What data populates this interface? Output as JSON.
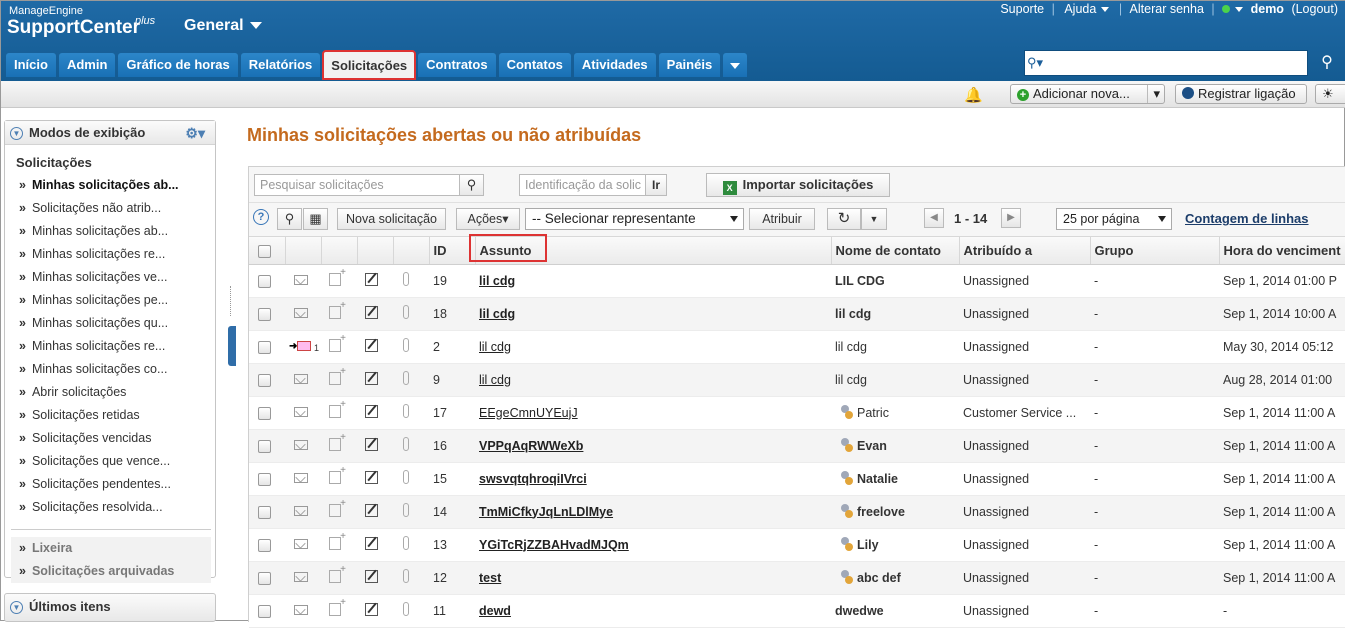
{
  "brand": {
    "small": "ManageEngine",
    "big": "SupportCenter",
    "plus": "plus"
  },
  "workspace": "General",
  "toplinks": {
    "support": "Suporte",
    "help": "Ajuda",
    "change_password": "Alterar senha",
    "user": "demo",
    "logout": "(Logout)"
  },
  "tabs": [
    "Início",
    "Admin",
    "Gráfico de horas",
    "Relatórios",
    "Solicitações",
    "Contratos",
    "Contatos",
    "Atividades",
    "Painéis"
  ],
  "active_tab": "Solicitações",
  "search": {
    "value": "",
    "go_label": "Ir"
  },
  "subbar": {
    "add_new": "Adicionar nova...",
    "register_call": "Registrar ligação"
  },
  "sidebar": {
    "title": "Modos de exibição",
    "section": "Solicitações",
    "items": [
      "Minhas solicitações ab...",
      "Solicitações não atrib...",
      "Minhas solicitações ab...",
      "Minhas solicitações re...",
      "Minhas solicitações ve...",
      "Minhas solicitações pe...",
      "Minhas solicitações qu...",
      "Minhas solicitações re...",
      "Minhas solicitações co...",
      "Abrir solicitações",
      "Solicitações retidas",
      "Solicitações vencidas",
      "Solicitações que vence...",
      "Solicitações pendentes...",
      "Solicitações resolvida..."
    ],
    "footer_items": [
      "Lixeira",
      "Solicitações arquivadas"
    ],
    "recent_title": "Últimos itens"
  },
  "main": {
    "title": "Minhas solicitações abertas ou não atribuídas",
    "search_placeholder": "Pesquisar solicitações",
    "id_placeholder": "Identificação da solic",
    "id_go": "Ir",
    "import_label": "Importar solicitações",
    "new_request": "Nova solicitação",
    "actions": "Ações",
    "select_rep": "-- Selecionar representante",
    "assign": "Atribuir",
    "pager": "1 - 14",
    "per_page": "25 por página",
    "count_link": "Contagem de linhas"
  },
  "table": {
    "headers": {
      "id": "ID",
      "subject": "Assunto",
      "contact": "Nome de contato",
      "assigned": "Atribuído a",
      "group": "Grupo",
      "due": "Hora do venciment"
    },
    "rows": [
      {
        "id": "19",
        "subject": "lil cdg",
        "contact": "LIL CDG",
        "assigned": "Unassigned",
        "group": "-",
        "due": "Sep 1, 2014 01:00 P"
      },
      {
        "id": "18",
        "subject": "lil cdg",
        "contact": "lil cdg",
        "assigned": "Unassigned",
        "group": "-",
        "due": "Sep 1, 2014 10:00 A"
      },
      {
        "id": "2",
        "subject": "lil cdg",
        "contact": "lil cdg",
        "assigned": "Unassigned",
        "group": "-",
        "due": "May 30, 2014 05:12"
      },
      {
        "id": "9",
        "subject": "lil cdg",
        "contact": "lil cdg",
        "assigned": "Unassigned",
        "group": "-",
        "due": "Aug 28, 2014 01:00"
      },
      {
        "id": "17",
        "subject": "EEgeCmnUYEujJ",
        "contact": "Patric",
        "assigned": "Customer Service ...",
        "group": "-",
        "due": "Sep 1, 2014 11:00 A"
      },
      {
        "id": "16",
        "subject": "VPPqAqRWWeXb",
        "contact": "Evan",
        "assigned": "Unassigned",
        "group": "-",
        "due": "Sep 1, 2014 11:00 A"
      },
      {
        "id": "15",
        "subject": "swsvqtqhroqiIVrci",
        "contact": "Natalie",
        "assigned": "Unassigned",
        "group": "-",
        "due": "Sep 1, 2014 11:00 A"
      },
      {
        "id": "14",
        "subject": "TmMiCfkyJqLnLDlMye",
        "contact": "freelove",
        "assigned": "Unassigned",
        "group": "-",
        "due": "Sep 1, 2014 11:00 A"
      },
      {
        "id": "13",
        "subject": "YGiTcRjZZBAHvadMJQm",
        "contact": "Lily",
        "assigned": "Unassigned",
        "group": "-",
        "due": "Sep 1, 2014 11:00 A"
      },
      {
        "id": "12",
        "subject": "test",
        "contact": "abc def",
        "assigned": "Unassigned",
        "group": "-",
        "due": "Sep 1, 2014 11:00 A"
      },
      {
        "id": "11",
        "subject": "dewd",
        "contact": "dwedwe",
        "assigned": "Unassigned",
        "group": "-",
        "due": "-"
      }
    ]
  },
  "colors": {
    "header_blue": "#1f6aa6",
    "title_orange": "#c46a1e",
    "highlight_red": "#dd3333"
  }
}
